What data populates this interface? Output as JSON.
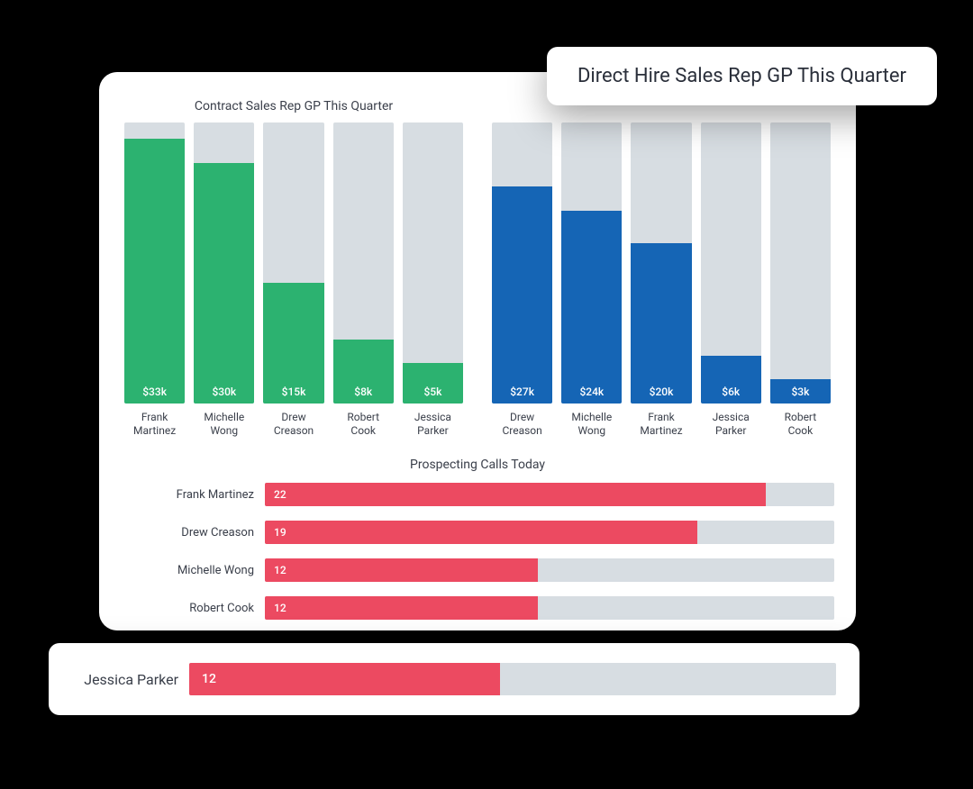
{
  "chart_data": [
    {
      "type": "bar",
      "title": "Contract Sales Rep GP This Quarter",
      "categories": [
        "Frank Martinez",
        "Michelle Wong",
        "Drew Creason",
        "Robert Cook",
        "Jessica Parker"
      ],
      "values": [
        33,
        30,
        15,
        8,
        5
      ],
      "value_labels": [
        "$33k",
        "$30k",
        "$15k",
        "$8k",
        "$5k"
      ],
      "ylim": [
        0,
        35
      ],
      "color": "#2cb270",
      "track_color": "#d7dde2"
    },
    {
      "type": "bar",
      "title": "Direct Hire Sales Rep GP This Quarter",
      "categories": [
        "Drew Creason",
        "Michelle Wong",
        "Frank Martinez",
        "Jessica Parker",
        "Robert Cook"
      ],
      "values": [
        27,
        24,
        20,
        6,
        3
      ],
      "value_labels": [
        "$27k",
        "$24k",
        "$20k",
        "$6k",
        "$3k"
      ],
      "ylim": [
        0,
        35
      ],
      "color": "#1565b5",
      "track_color": "#d7dde2"
    },
    {
      "type": "bar",
      "orientation": "horizontal",
      "title": "Prospecting Calls Today",
      "categories": [
        "Frank Martinez",
        "Drew Creason",
        "Michelle Wong",
        "Robert Cook",
        "Jessica Parker"
      ],
      "values": [
        22,
        19,
        12,
        12,
        12
      ],
      "xlim": [
        0,
        25
      ],
      "color": "#ec4a61",
      "track_color": "#d7dde2"
    }
  ],
  "float_title_text": "Direct Hire Sales Rep GP This Quarter",
  "float_row": {
    "label": "Jessica Parker",
    "value": 12,
    "max": 25
  }
}
